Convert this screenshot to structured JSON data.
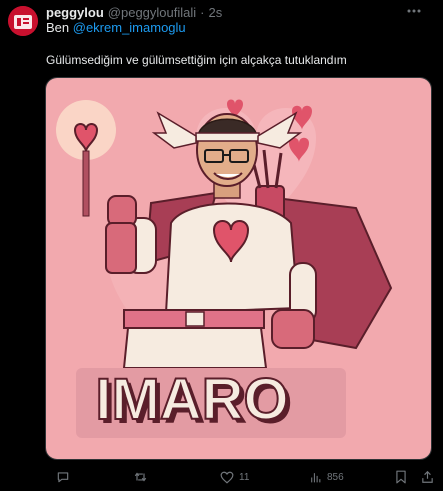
{
  "tweet": {
    "display_name": "peggylou",
    "handle": "@peggyloufilali",
    "separator": "·",
    "time": "2s",
    "text_prefix": "Ben ",
    "mention": "@ekrem_imamoglu",
    "body": "Gülümsediğim ve gülümsettiğim için alçakça tutuklandım"
  },
  "media": {
    "caption_text": "IMARO"
  },
  "actions": {
    "reply_icon": "comment-icon",
    "retweet_icon": "retweet-icon",
    "like_icon": "heart-icon",
    "like_count": "11",
    "views_icon": "bar-chart-icon",
    "views_count": "856",
    "bookmark_icon": "bookmark-icon",
    "share_icon": "share-icon"
  },
  "colors": {
    "background": "#000000",
    "text": "#e7e9ea",
    "muted": "#71767b",
    "link": "#1d9bf0",
    "image_bg": "#f2a9ae"
  }
}
